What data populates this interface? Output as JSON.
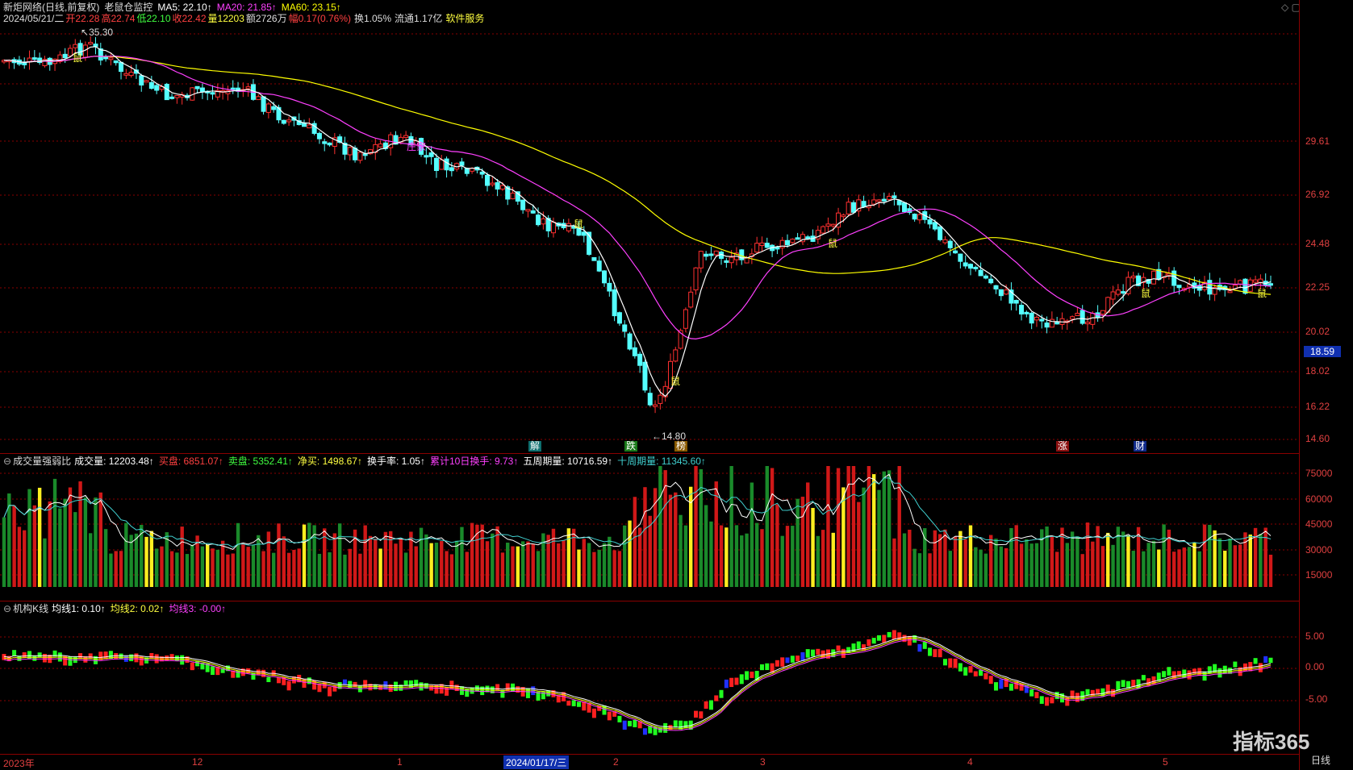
{
  "header": {
    "stock": "新炬网络(日线,前复权)",
    "indicator": "老鼠仓监控",
    "ma5": "MA5: 22.10↑",
    "ma20": "MA20: 21.85↑",
    "ma60": "MA60: 23.15↑"
  },
  "quote": {
    "date": "2024/05/21/二",
    "open": "开22.28",
    "high": "高22.74",
    "low": "低22.10",
    "close": "收22.42",
    "volume": "量12203",
    "amount": "额2726万",
    "change": "幅0.17(0.76%)",
    "turnover": "换1.05%",
    "float": "流通1.17亿",
    "sector": "软件服务"
  },
  "volume_panel": {
    "title": "成交量强弱比",
    "vol": "成交量: 12203.48↑",
    "buy": "买盘: 6851.07↑",
    "sell": "卖盘: 5352.41↑",
    "net": "净买: 1498.67↑",
    "turnover": "换手率: 1.05↑",
    "cum10": "累计10日换手: 9.73↑",
    "wk5": "五周期量: 10716.59↑",
    "wk10": "十周期量: 11345.60↑"
  },
  "inst_panel": {
    "title": "机构K线",
    "l1": "均线1: 0.10↑",
    "l2": "均线2: 0.02↑",
    "l3": "均线3: -0.00↑"
  },
  "price_axis": [
    "29.61",
    "26.92",
    "24.48",
    "22.25",
    "20.02",
    "18.02",
    "16.22",
    "14.60"
  ],
  "current_price": "18.59",
  "vol_axis": [
    "75000",
    "60000",
    "45000",
    "30000",
    "15000"
  ],
  "inst_axis": [
    "5.00",
    "0.00",
    "-5.00"
  ],
  "dates": [
    "2023年",
    "12",
    "1",
    "2",
    "3",
    "4",
    "5"
  ],
  "selected_date": "2024/01/17/三",
  "annotations": {
    "high": "35.30",
    "low": "14.80",
    "tags": [
      "解",
      "跌",
      "榜",
      "涨",
      "财"
    ],
    "rat": "鼠",
    "zhu": "庄家"
  },
  "period": "日线",
  "brand": "指标365",
  "colors": {
    "up": "#ff3030",
    "down": "#54ffff",
    "ma5": "#ffffff",
    "ma20": "#ff40ff",
    "ma60": "#ffff00",
    "grid": "#8a0000"
  }
}
